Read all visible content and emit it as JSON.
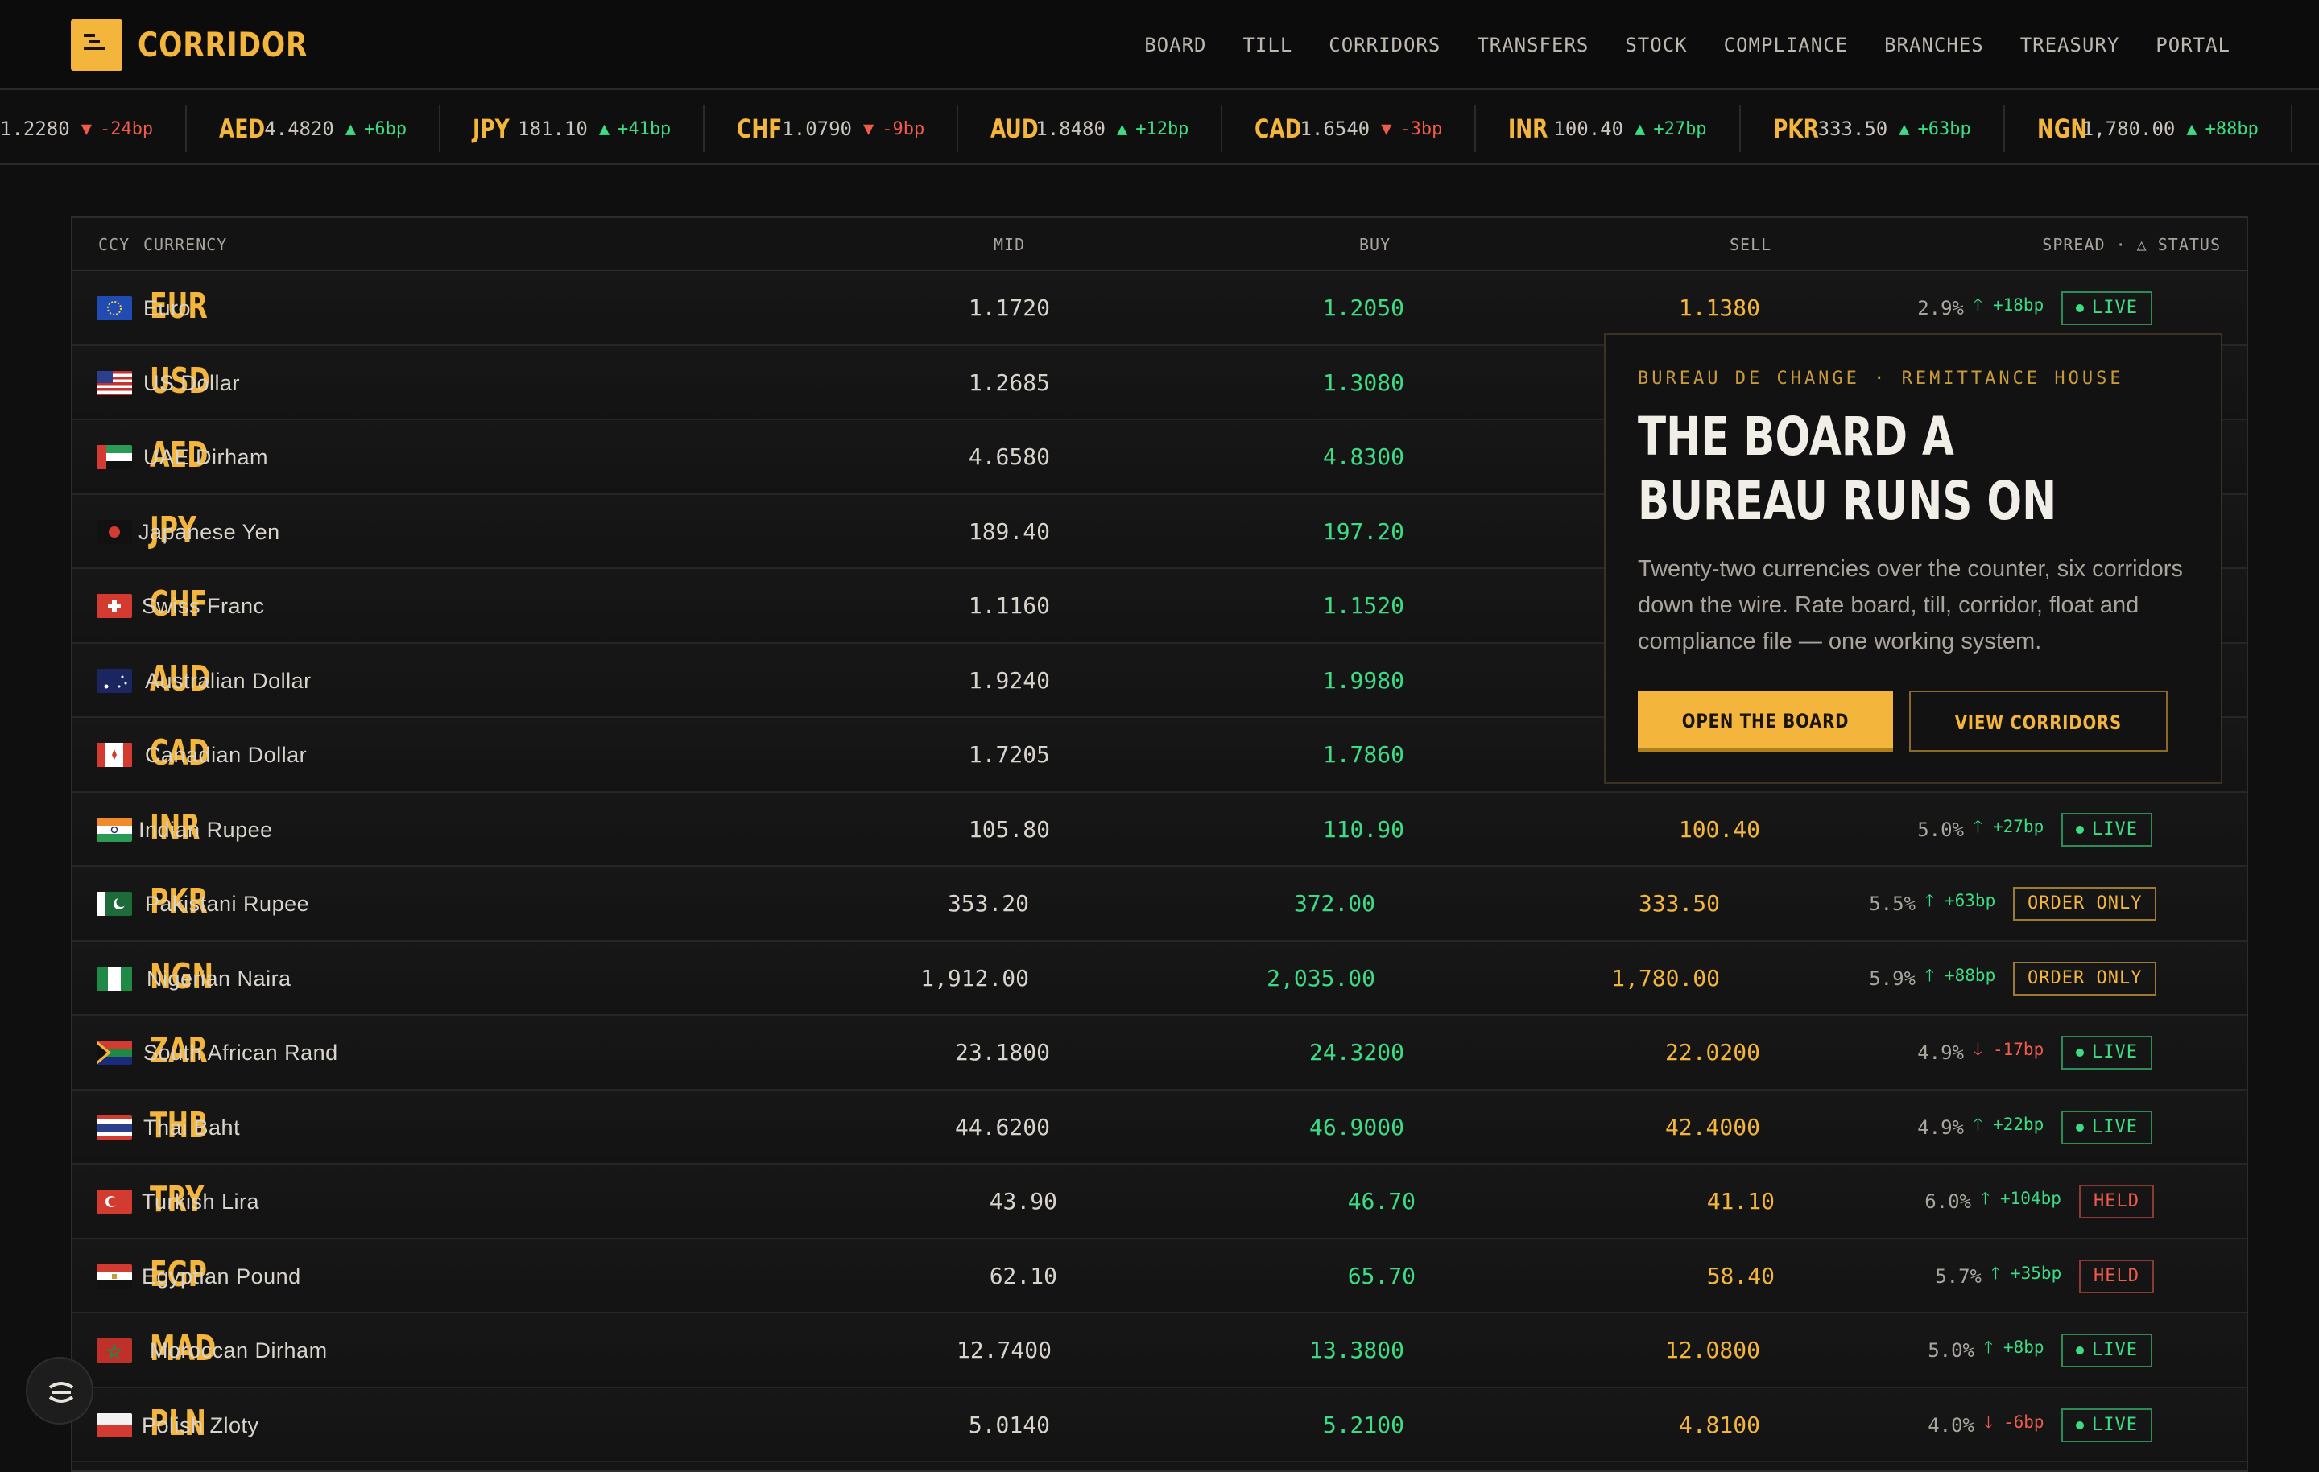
{
  "brand": {
    "name": "CORRIDOR"
  },
  "nav": [
    "BOARD",
    "TILL",
    "CORRIDORS",
    "TRANSFERS",
    "STOCK",
    "COMPLIANCE",
    "BRANCHES",
    "TREASURY",
    "PORTAL"
  ],
  "ticker": [
    {
      "code": "",
      "rate": "1.2280",
      "dir": "down",
      "chg": "-24bp"
    },
    {
      "code": "AED",
      "rate": "4.4820",
      "dir": "up",
      "chg": "+6bp"
    },
    {
      "code": "JPY",
      "rate": "181.10",
      "dir": "up",
      "chg": "+41bp"
    },
    {
      "code": "CHF",
      "rate": "1.0790",
      "dir": "down",
      "chg": "-9bp"
    },
    {
      "code": "AUD",
      "rate": "1.8480",
      "dir": "up",
      "chg": "+12bp"
    },
    {
      "code": "CAD",
      "rate": "1.6540",
      "dir": "down",
      "chg": "-3bp"
    },
    {
      "code": "INR",
      "rate": "100.40",
      "dir": "up",
      "chg": "+27bp"
    },
    {
      "code": "PKR",
      "rate": "333.50",
      "dir": "up",
      "chg": "+63bp"
    },
    {
      "code": "NGN",
      "rate": "1,780.00",
      "dir": "up",
      "chg": "+88bp"
    }
  ],
  "table": {
    "headers": {
      "ccy": "CCY",
      "currency": "CURRENCY",
      "mid": "MID",
      "buy": "BUY",
      "sell": "SELL",
      "spread_status": "SPREAD · △ STATUS"
    },
    "rows": [
      {
        "code": "EUR",
        "name": "Euro",
        "mid": "1.1720",
        "buy": "1.2050",
        "sell": "1.1380",
        "spread": "2.9%",
        "dir": "up",
        "chg": "+18bp",
        "status": "LIVE",
        "flag": "eu"
      },
      {
        "code": "USD",
        "name": "US Dollar",
        "mid": "1.2685",
        "buy": "1.3080",
        "sell": "",
        "spread": "",
        "dir": "",
        "chg": "",
        "status": "",
        "flag": "us"
      },
      {
        "code": "AED",
        "name": "UAE Dirham",
        "mid": "4.6580",
        "buy": "4.8300",
        "sell": "",
        "spread": "",
        "dir": "",
        "chg": "",
        "status": "",
        "flag": "ae"
      },
      {
        "code": "JPY",
        "name": "Japanese Yen",
        "mid": "189.40",
        "buy": "197.20",
        "sell": "",
        "spread": "",
        "dir": "",
        "chg": "",
        "status": "",
        "flag": "jp"
      },
      {
        "code": "CHF",
        "name": "Swiss Franc",
        "mid": "1.1160",
        "buy": "1.1520",
        "sell": "",
        "spread": "",
        "dir": "",
        "chg": "",
        "status": "",
        "flag": "ch"
      },
      {
        "code": "AUD",
        "name": "Australian Dollar",
        "mid": "1.9240",
        "buy": "1.9980",
        "sell": "",
        "spread": "",
        "dir": "",
        "chg": "",
        "status": "",
        "flag": "au"
      },
      {
        "code": "CAD",
        "name": "Canadian Dollar",
        "mid": "1.7205",
        "buy": "1.7860",
        "sell": "",
        "spread": "",
        "dir": "",
        "chg": "",
        "status": "",
        "flag": "ca"
      },
      {
        "code": "INR",
        "name": "Indian Rupee",
        "mid": "105.80",
        "buy": "110.90",
        "sell": "100.40",
        "spread": "5.0%",
        "dir": "up",
        "chg": "+27bp",
        "status": "LIVE",
        "flag": "in"
      },
      {
        "code": "PKR",
        "name": "Pakistani Rupee",
        "mid": "353.20",
        "buy": "372.00",
        "sell": "333.50",
        "spread": "5.5%",
        "dir": "up",
        "chg": "+63bp",
        "status": "ORDER ONLY",
        "flag": "pk"
      },
      {
        "code": "NGN",
        "name": "Nigerian Naira",
        "mid": "1,912.00",
        "buy": "2,035.00",
        "sell": "1,780.00",
        "spread": "5.9%",
        "dir": "up",
        "chg": "+88bp",
        "status": "ORDER ONLY",
        "flag": "ng"
      },
      {
        "code": "ZAR",
        "name": "South African Rand",
        "mid": "23.1800",
        "buy": "24.3200",
        "sell": "22.0200",
        "spread": "4.9%",
        "dir": "down",
        "chg": "-17bp",
        "status": "LIVE",
        "flag": "za"
      },
      {
        "code": "THB",
        "name": "Thai Baht",
        "mid": "44.6200",
        "buy": "46.9000",
        "sell": "42.4000",
        "spread": "4.9%",
        "dir": "up",
        "chg": "+22bp",
        "status": "LIVE",
        "flag": "th"
      },
      {
        "code": "TRY",
        "name": "Turkish Lira",
        "mid": "43.90",
        "buy": "46.70",
        "sell": "41.10",
        "spread": "6.0%",
        "dir": "up",
        "chg": "+104bp",
        "status": "HELD",
        "flag": "tr"
      },
      {
        "code": "EGP",
        "name": "Egyptian Pound",
        "mid": "62.10",
        "buy": "65.70",
        "sell": "58.40",
        "spread": "5.7%",
        "dir": "up",
        "chg": "+35bp",
        "status": "HELD",
        "flag": "eg"
      },
      {
        "code": "MAD",
        "name": "Moroccan Dirham",
        "mid": "12.7400",
        "buy": "13.3800",
        "sell": "12.0800",
        "spread": "5.0%",
        "dir": "up",
        "chg": "+8bp",
        "status": "LIVE",
        "flag": "ma"
      },
      {
        "code": "PLN",
        "name": "Polish Zloty",
        "mid": "5.0140",
        "buy": "5.2100",
        "sell": "4.8100",
        "spread": "4.0%",
        "dir": "down",
        "chg": "-6bp",
        "status": "LIVE",
        "flag": "pl"
      }
    ]
  },
  "hero": {
    "kicker": "BUREAU DE CHANGE · REMITTANCE HOUSE",
    "title_line1": "THE BOARD A",
    "title_line2": "BUREAU RUNS ON",
    "body": "Twenty-two currencies over the counter, six corridors down the wire. Rate board, till, corridor, float and compliance file — one working system.",
    "primary_cta": "OPEN THE BOARD",
    "secondary_cta": "VIEW CORRIDORS"
  },
  "colors": {
    "accent": "#f3b53c",
    "up": "#3ddc84",
    "down": "#f05b4b",
    "bg": "#0f0f0f"
  }
}
